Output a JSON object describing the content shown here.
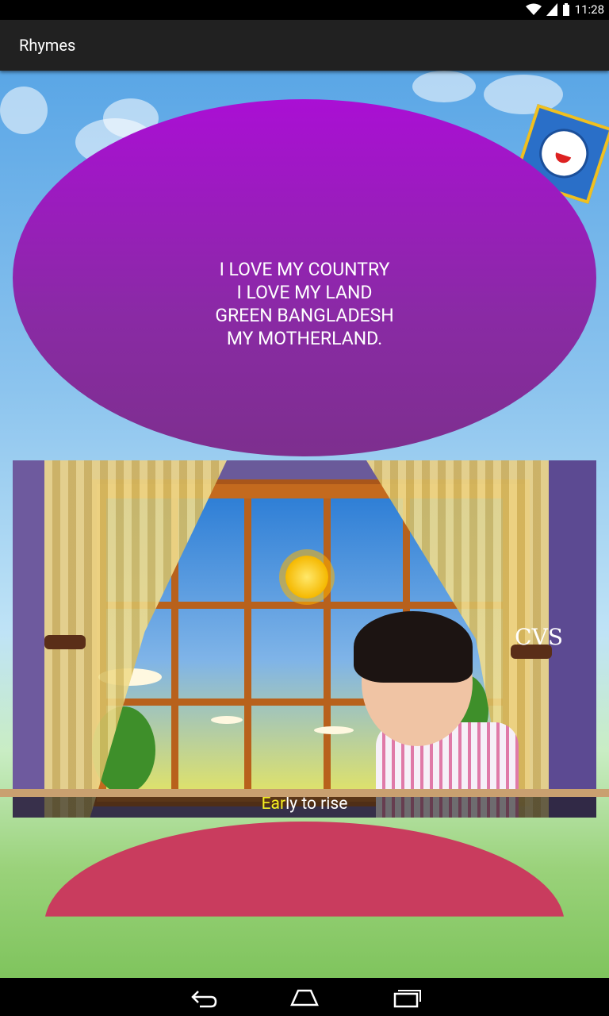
{
  "status_bar": {
    "time": "11:28",
    "icons": [
      "wifi-icon",
      "signal-icon",
      "battery-icon"
    ]
  },
  "action_bar": {
    "title": "Rhymes"
  },
  "rhyme_card": {
    "lines": [
      "I LOVE MY COUNTRY",
      "I LOVE MY LAND",
      "GREEN BANGLADESH",
      "MY MOTHERLAND."
    ],
    "color": "#9b1fc0"
  },
  "video": {
    "watermark": "CVS",
    "subtitle_highlight": "Ear",
    "subtitle_rest": "ly to rise"
  },
  "bottom_shape": {
    "color": "#c93c5e"
  },
  "nav_bar": {
    "buttons": [
      "back-icon",
      "home-icon",
      "recents-icon"
    ]
  }
}
